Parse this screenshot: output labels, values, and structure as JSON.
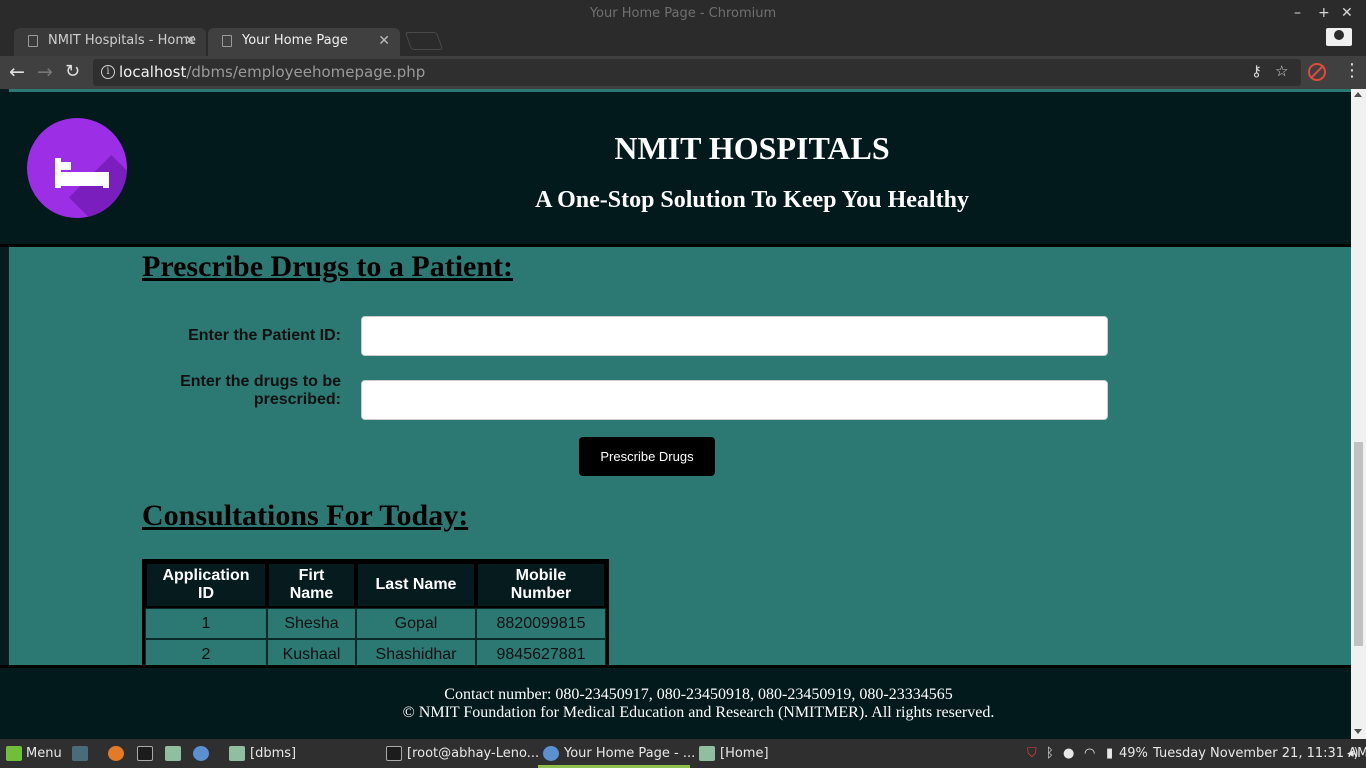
{
  "window": {
    "title": "Your Home Page - Chromium"
  },
  "tabs": [
    {
      "label": "NMIT Hospitals - Home",
      "active": false
    },
    {
      "label": "Your Home Page",
      "active": true
    }
  ],
  "address_bar": {
    "host": "localhost",
    "path": "/dbms/employeehomepage.php"
  },
  "site": {
    "title": "NMIT HOSPITALS",
    "tagline": "A One-Stop Solution To Keep You Healthy",
    "logo_icon": "bed-icon",
    "colors": {
      "header_bg": "#021a1c",
      "page_bg": "#2c7873",
      "logo": "#9c2ee6"
    }
  },
  "prescribe": {
    "heading": "Prescribe Drugs to a Patient:",
    "patient_id_label": "Enter the Patient ID:",
    "patient_id_value": "",
    "drugs_label": "Enter the drugs to be prescribed:",
    "drugs_value": "",
    "submit_label": "Prescribe Drugs"
  },
  "consultations": {
    "heading": "Consultations For Today:",
    "columns": [
      "Application ID",
      "Firt Name",
      "Last Name",
      "Mobile Number"
    ],
    "rows": [
      [
        "1",
        "Shesha",
        "Gopal",
        "8820099815"
      ],
      [
        "2",
        "Kushaal",
        "Shashidhar",
        "9845627881"
      ]
    ]
  },
  "footer": {
    "contact": "Contact number: 080-23450917, 080-23450918, 080-23450919, 080-23334565",
    "copyright": "© NMIT Foundation for Medical Education and Research (NMITMER). All rights reserved."
  },
  "taskbar": {
    "menu_label": "Menu",
    "windows": [
      {
        "label": "[dbms]",
        "active": false
      },
      {
        "label": "[root@abhay-Leno...",
        "active": false
      },
      {
        "label": "Your Home Page - ...",
        "active": true
      },
      {
        "label": "[Home]",
        "active": false
      }
    ],
    "battery": "49%",
    "clock": "Tuesday November 21, 11:31 AM"
  }
}
